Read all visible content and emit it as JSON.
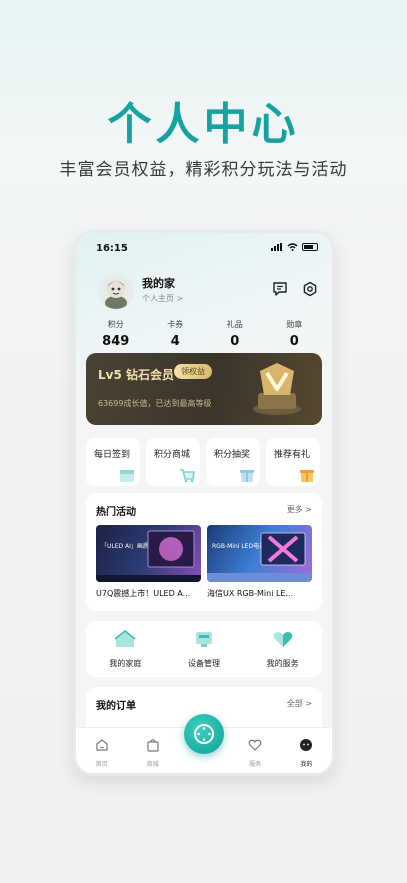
{
  "hero": {
    "title": "个人中心",
    "subtitle": "丰富会员权益，精彩积分玩法与活动"
  },
  "colors": {
    "accent": "#14a3a0",
    "vip_gold": "#f2dfae"
  },
  "status_bar": {
    "time": "16:15"
  },
  "profile": {
    "name": "我的家",
    "link": "个人主页 >"
  },
  "header_icons": [
    "message-icon",
    "settings-icon"
  ],
  "stats": [
    {
      "label": "积分",
      "value": "849"
    },
    {
      "label": "卡券",
      "value": "4"
    },
    {
      "label": "礼品",
      "value": "0"
    },
    {
      "label": "勋章",
      "value": "0"
    }
  ],
  "vip": {
    "title": "Lv5 钻石会员",
    "button": "领权益",
    "desc": "63699成长值，已达到最高等级"
  },
  "quick_actions": [
    {
      "label": "每日签到",
      "icon": "calendar-icon"
    },
    {
      "label": "积分商城",
      "icon": "cart-icon"
    },
    {
      "label": "积分抽奖",
      "icon": "gift-box-icon"
    },
    {
      "label": "推荐有礼",
      "icon": "present-icon"
    }
  ],
  "activities": {
    "title": "热门活动",
    "more": "更多 >",
    "items": [
      {
        "banner_text": "「ULED AI」画质专家",
        "caption": "U7Q震撼上市！ULED A..."
      },
      {
        "banner_text": "RGB-Mini LED电视",
        "caption": "海信UX RGB-Mini LE..."
      }
    ]
  },
  "services": [
    {
      "label": "我的家庭",
      "icon": "home-icon"
    },
    {
      "label": "设备管理",
      "icon": "device-icon"
    },
    {
      "label": "我的服务",
      "icon": "heart-service-icon"
    }
  ],
  "orders": {
    "title": "我的订单",
    "more": "全部 >"
  },
  "tabbar": [
    {
      "label": "首页",
      "icon": "home-tab-icon"
    },
    {
      "label": "商城",
      "icon": "bag-tab-icon"
    },
    {
      "label": "服务",
      "icon": "heart-tab-icon"
    },
    {
      "label": "我的",
      "icon": "face-tab-icon"
    }
  ]
}
